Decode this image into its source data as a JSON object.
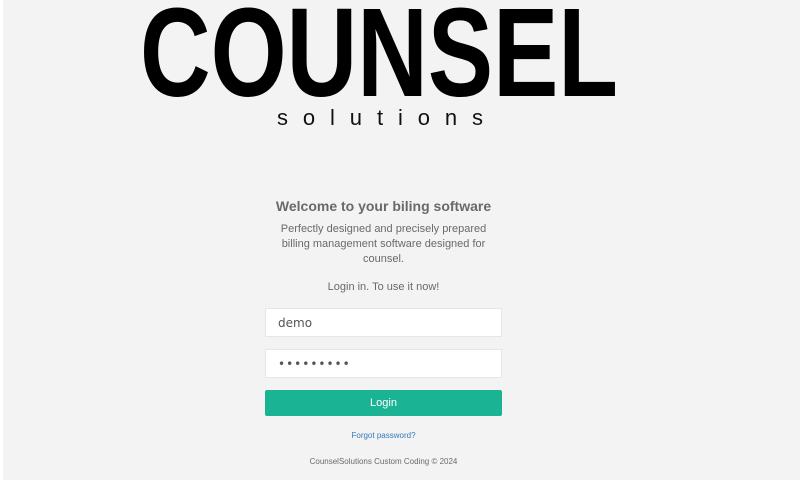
{
  "brand": {
    "name": "COUNSEL",
    "subtitle": "solutions"
  },
  "login": {
    "heading": "Welcome to your biling software",
    "description": "Perfectly designed and precisely prepared billing management software designed for counsel.",
    "prompt": "Login in. To use it now!",
    "username_value": "demo",
    "password_value": "•••••••••",
    "button_label": "Login",
    "forgot_label": "Forgot password?",
    "footer": "CounselSolutions Custom Coding © 2024"
  },
  "colors": {
    "accent": "#1ab394",
    "link": "#337ab7",
    "background": "#f3f3f4",
    "text": "#676a6c"
  }
}
